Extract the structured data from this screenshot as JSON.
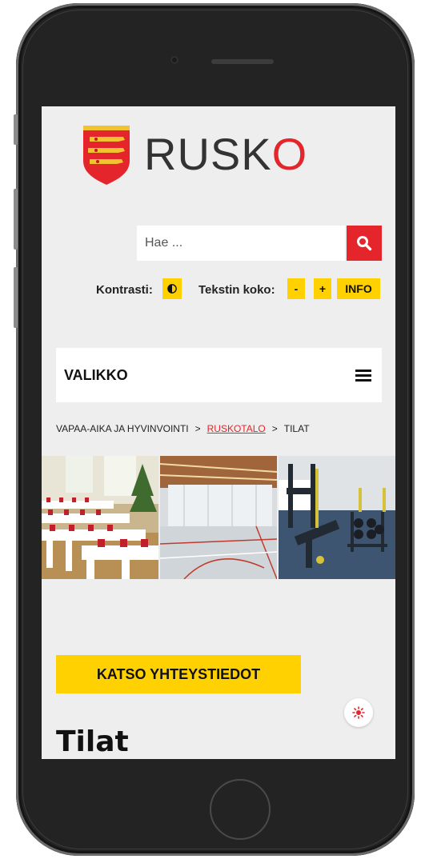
{
  "header": {
    "logo_text_main": "RUSK",
    "logo_text_last": "O"
  },
  "search": {
    "placeholder": "Hae ..."
  },
  "accessibility": {
    "contrast_label": "Kontrasti:",
    "text_size_label": "Tekstin koko:",
    "decrease_label": "-",
    "increase_label": "+",
    "info_label": "INFO"
  },
  "nav": {
    "menu_label": "VALIKKO"
  },
  "breadcrumb": {
    "separator": ">",
    "items": [
      "VAPAA-AIKA JA HYVINVOINTI",
      "RUSKOTALO",
      "TILAT"
    ]
  },
  "gallery": {
    "photos": [
      "banquet-hall-photo",
      "sports-hall-photo",
      "gym-photo"
    ]
  },
  "main": {
    "cta_label": "KATSO YHTEYSTIEDOT",
    "page_title": "Tilat"
  },
  "colors": {
    "brand_red": "#e4252b",
    "accent_yellow": "#ffd100",
    "background": "#eeeeee"
  }
}
